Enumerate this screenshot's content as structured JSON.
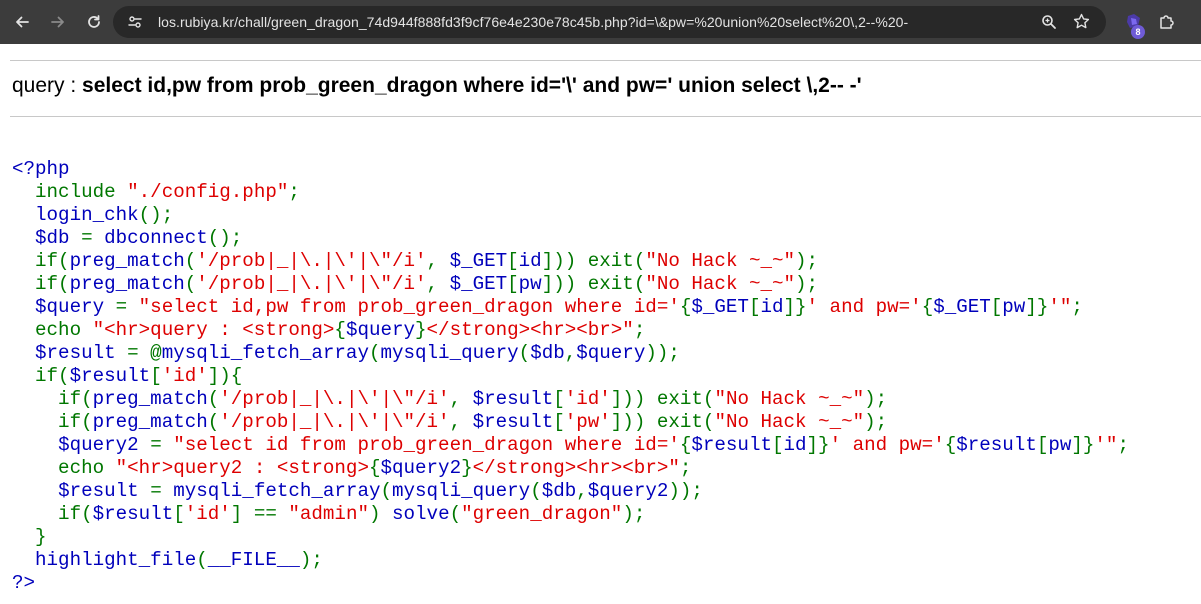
{
  "browser": {
    "url": "los.rubiya.kr/chall/green_dragon_74d944f888fd3f9cf76e4e230e78c45b.php?id=\\&pw=%20union%20select%20\\,2--%20-",
    "extension_badge": "8"
  },
  "page": {
    "query_label": "query : ",
    "query_value": "select id,pw from prob_green_dragon where id='\\' and pw=' union select \\,2-- -'"
  },
  "code_lines": [
    [
      {
        "c": "v",
        "t": "<?php"
      }
    ],
    [
      {
        "c": "k",
        "t": "  include "
      },
      {
        "c": "s",
        "t": "\"./config.php\""
      },
      {
        "c": "k",
        "t": ";"
      }
    ],
    [
      {
        "c": "k",
        "t": "  "
      },
      {
        "c": "v",
        "t": "login_chk"
      },
      {
        "c": "k",
        "t": "();"
      }
    ],
    [
      {
        "c": "k",
        "t": "  "
      },
      {
        "c": "v",
        "t": "$db "
      },
      {
        "c": "k",
        "t": "= "
      },
      {
        "c": "v",
        "t": "dbconnect"
      },
      {
        "c": "k",
        "t": "();"
      }
    ],
    [
      {
        "c": "k",
        "t": "  if("
      },
      {
        "c": "v",
        "t": "preg_match"
      },
      {
        "c": "k",
        "t": "("
      },
      {
        "c": "s",
        "t": "'/prob|_|\\.|\\'|\\\"/i'"
      },
      {
        "c": "k",
        "t": ", "
      },
      {
        "c": "v",
        "t": "$_GET"
      },
      {
        "c": "k",
        "t": "["
      },
      {
        "c": "v",
        "t": "id"
      },
      {
        "c": "k",
        "t": "])) exit("
      },
      {
        "c": "s",
        "t": "\"No Hack ~_~\""
      },
      {
        "c": "k",
        "t": ");"
      }
    ],
    [
      {
        "c": "k",
        "t": "  if("
      },
      {
        "c": "v",
        "t": "preg_match"
      },
      {
        "c": "k",
        "t": "("
      },
      {
        "c": "s",
        "t": "'/prob|_|\\.|\\'|\\\"/i'"
      },
      {
        "c": "k",
        "t": ", "
      },
      {
        "c": "v",
        "t": "$_GET"
      },
      {
        "c": "k",
        "t": "["
      },
      {
        "c": "v",
        "t": "pw"
      },
      {
        "c": "k",
        "t": "])) exit("
      },
      {
        "c": "s",
        "t": "\"No Hack ~_~\""
      },
      {
        "c": "k",
        "t": ");"
      }
    ],
    [
      {
        "c": "k",
        "t": "  "
      },
      {
        "c": "v",
        "t": "$query "
      },
      {
        "c": "k",
        "t": "= "
      },
      {
        "c": "s",
        "t": "\"select id,pw from prob_green_dragon where id='"
      },
      {
        "c": "k",
        "t": "{"
      },
      {
        "c": "v",
        "t": "$_GET"
      },
      {
        "c": "k",
        "t": "["
      },
      {
        "c": "v",
        "t": "id"
      },
      {
        "c": "k",
        "t": "]}"
      },
      {
        "c": "s",
        "t": "' and pw='"
      },
      {
        "c": "k",
        "t": "{"
      },
      {
        "c": "v",
        "t": "$_GET"
      },
      {
        "c": "k",
        "t": "["
      },
      {
        "c": "v",
        "t": "pw"
      },
      {
        "c": "k",
        "t": "]}"
      },
      {
        "c": "s",
        "t": "'\""
      },
      {
        "c": "k",
        "t": ";"
      }
    ],
    [
      {
        "c": "k",
        "t": "  echo "
      },
      {
        "c": "s",
        "t": "\"<hr>query : <strong>"
      },
      {
        "c": "k",
        "t": "{"
      },
      {
        "c": "v",
        "t": "$query"
      },
      {
        "c": "k",
        "t": "}"
      },
      {
        "c": "s",
        "t": "</strong><hr><br>\""
      },
      {
        "c": "k",
        "t": ";"
      }
    ],
    [
      {
        "c": "k",
        "t": "  "
      },
      {
        "c": "v",
        "t": "$result "
      },
      {
        "c": "k",
        "t": "= @"
      },
      {
        "c": "v",
        "t": "mysqli_fetch_array"
      },
      {
        "c": "k",
        "t": "("
      },
      {
        "c": "v",
        "t": "mysqli_query"
      },
      {
        "c": "k",
        "t": "("
      },
      {
        "c": "v",
        "t": "$db"
      },
      {
        "c": "k",
        "t": ","
      },
      {
        "c": "v",
        "t": "$query"
      },
      {
        "c": "k",
        "t": "));"
      }
    ],
    [
      {
        "c": "k",
        "t": "  if("
      },
      {
        "c": "v",
        "t": "$result"
      },
      {
        "c": "k",
        "t": "["
      },
      {
        "c": "s",
        "t": "'id'"
      },
      {
        "c": "k",
        "t": "]){"
      }
    ],
    [
      {
        "c": "k",
        "t": "    if("
      },
      {
        "c": "v",
        "t": "preg_match"
      },
      {
        "c": "k",
        "t": "("
      },
      {
        "c": "s",
        "t": "'/prob|_|\\.|\\'|\\\"/i'"
      },
      {
        "c": "k",
        "t": ", "
      },
      {
        "c": "v",
        "t": "$result"
      },
      {
        "c": "k",
        "t": "["
      },
      {
        "c": "s",
        "t": "'id'"
      },
      {
        "c": "k",
        "t": "])) exit("
      },
      {
        "c": "s",
        "t": "\"No Hack ~_~\""
      },
      {
        "c": "k",
        "t": ");"
      }
    ],
    [
      {
        "c": "k",
        "t": "    if("
      },
      {
        "c": "v",
        "t": "preg_match"
      },
      {
        "c": "k",
        "t": "("
      },
      {
        "c": "s",
        "t": "'/prob|_|\\.|\\'|\\\"/i'"
      },
      {
        "c": "k",
        "t": ", "
      },
      {
        "c": "v",
        "t": "$result"
      },
      {
        "c": "k",
        "t": "["
      },
      {
        "c": "s",
        "t": "'pw'"
      },
      {
        "c": "k",
        "t": "])) exit("
      },
      {
        "c": "s",
        "t": "\"No Hack ~_~\""
      },
      {
        "c": "k",
        "t": ");"
      }
    ],
    [
      {
        "c": "k",
        "t": "    "
      },
      {
        "c": "v",
        "t": "$query2 "
      },
      {
        "c": "k",
        "t": "= "
      },
      {
        "c": "s",
        "t": "\"select id from prob_green_dragon where id='"
      },
      {
        "c": "k",
        "t": "{"
      },
      {
        "c": "v",
        "t": "$result"
      },
      {
        "c": "k",
        "t": "["
      },
      {
        "c": "v",
        "t": "id"
      },
      {
        "c": "k",
        "t": "]}"
      },
      {
        "c": "s",
        "t": "' and pw='"
      },
      {
        "c": "k",
        "t": "{"
      },
      {
        "c": "v",
        "t": "$result"
      },
      {
        "c": "k",
        "t": "["
      },
      {
        "c": "v",
        "t": "pw"
      },
      {
        "c": "k",
        "t": "]}"
      },
      {
        "c": "s",
        "t": "'\""
      },
      {
        "c": "k",
        "t": ";"
      }
    ],
    [
      {
        "c": "k",
        "t": "    echo "
      },
      {
        "c": "s",
        "t": "\"<hr>query2 : <strong>"
      },
      {
        "c": "k",
        "t": "{"
      },
      {
        "c": "v",
        "t": "$query2"
      },
      {
        "c": "k",
        "t": "}"
      },
      {
        "c": "s",
        "t": "</strong><hr><br>\""
      },
      {
        "c": "k",
        "t": ";"
      }
    ],
    [
      {
        "c": "k",
        "t": "    "
      },
      {
        "c": "v",
        "t": "$result "
      },
      {
        "c": "k",
        "t": "= "
      },
      {
        "c": "v",
        "t": "mysqli_fetch_array"
      },
      {
        "c": "k",
        "t": "("
      },
      {
        "c": "v",
        "t": "mysqli_query"
      },
      {
        "c": "k",
        "t": "("
      },
      {
        "c": "v",
        "t": "$db"
      },
      {
        "c": "k",
        "t": ","
      },
      {
        "c": "v",
        "t": "$query2"
      },
      {
        "c": "k",
        "t": "));"
      }
    ],
    [
      {
        "c": "k",
        "t": "    if("
      },
      {
        "c": "v",
        "t": "$result"
      },
      {
        "c": "k",
        "t": "["
      },
      {
        "c": "s",
        "t": "'id'"
      },
      {
        "c": "k",
        "t": "] == "
      },
      {
        "c": "s",
        "t": "\"admin\""
      },
      {
        "c": "k",
        "t": ") "
      },
      {
        "c": "v",
        "t": "solve"
      },
      {
        "c": "k",
        "t": "("
      },
      {
        "c": "s",
        "t": "\"green_dragon\""
      },
      {
        "c": "k",
        "t": ");"
      }
    ],
    [
      {
        "c": "k",
        "t": "  }"
      }
    ],
    [
      {
        "c": "k",
        "t": "  "
      },
      {
        "c": "v",
        "t": "highlight_file"
      },
      {
        "c": "k",
        "t": "("
      },
      {
        "c": "v",
        "t": "__FILE__"
      },
      {
        "c": "k",
        "t": ");"
      }
    ],
    [
      {
        "c": "v",
        "t": "?>"
      }
    ]
  ],
  "colors": {
    "keyword": "#007700",
    "string": "#dd0000",
    "default": "#0000bb",
    "chrome_bg": "#3c3c3c",
    "omnibox_bg": "#282828"
  }
}
